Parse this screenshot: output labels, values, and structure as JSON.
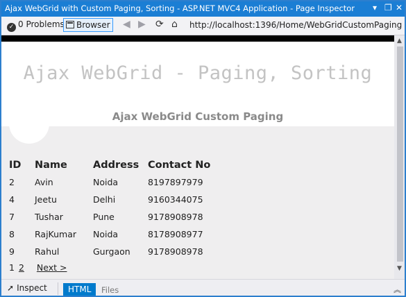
{
  "window": {
    "title": "Ajax WebGrid with Custom Paging, Sorting - ASP.NET MVC4 Application - Page Inspector",
    "controls": {
      "dropdown": "▾",
      "restore": "❐",
      "close": "✕"
    }
  },
  "toolbar": {
    "problems_label": "0 Problems",
    "browser_label": "Browser",
    "url": "http://localhost:1396/Home/WebGridCustomPaging"
  },
  "page": {
    "banner_title": "Ajax WebGrid - Paging, Sorting",
    "subtitle": "Ajax WebGrid Custom Paging"
  },
  "grid": {
    "headers": [
      "ID",
      "Name",
      "Address",
      "Contact No"
    ],
    "rows": [
      [
        "2",
        "Avin",
        "Noida",
        "8197897979"
      ],
      [
        "4",
        "Jeetu",
        "Delhi",
        "9160344075"
      ],
      [
        "7",
        "Tushar",
        "Pune",
        "9178908978"
      ],
      [
        "8",
        "RajKumar",
        "Noida",
        "8178908977"
      ],
      [
        "9",
        "Rahul",
        "Gurgaon",
        "9178908978"
      ]
    ]
  },
  "pager": {
    "current_page": "1",
    "pages": [
      "1",
      "2"
    ],
    "next_label": "Next >"
  },
  "bottombar": {
    "inspect_label": "Inspect",
    "tabs": [
      "HTML",
      "Files"
    ]
  },
  "colors": {
    "accent": "#1b7ed4",
    "active_tab": "#007acc",
    "banner_text": "#c3c3c3",
    "subtitle_text": "#8a8a8a"
  },
  "icons": [
    "problems-icon",
    "browser-icon",
    "back-icon",
    "forward-icon",
    "refresh-icon",
    "home-icon",
    "cursor-icon",
    "collapse-icon"
  ]
}
